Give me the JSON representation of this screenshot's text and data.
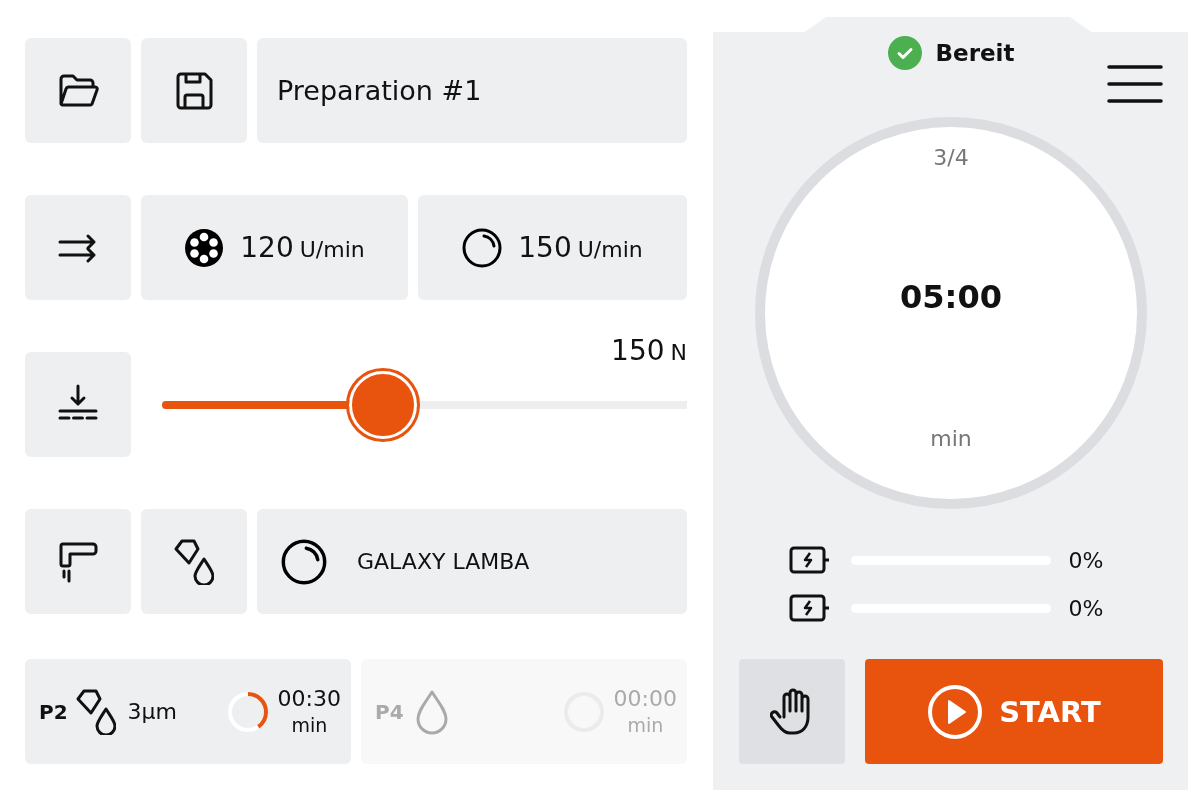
{
  "toolbar": {
    "preparation_name": "Preparation #1"
  },
  "speeds": [
    {
      "kind": "reel",
      "value": "120",
      "unit": "U/min"
    },
    {
      "kind": "disc",
      "value": "150",
      "unit": "U/min"
    }
  ],
  "force": {
    "value": "150",
    "unit": "N",
    "level": 0.42
  },
  "consumable": {
    "kind": "disc",
    "name": "GALAXY LAMBA"
  },
  "steps": [
    {
      "label": "P2",
      "kind": "diamond-drop",
      "amount": "3µm",
      "time": "00:30",
      "unit": "min",
      "disabled": false
    },
    {
      "label": "P4",
      "kind": "drop",
      "time": "00:00",
      "unit": "min",
      "disabled": true
    }
  ],
  "status": {
    "label": "Bereit"
  },
  "timer": {
    "step": "3/4",
    "time": "05:00",
    "unit": "min"
  },
  "batteries": [
    {
      "level": 0,
      "reading": "0%"
    },
    {
      "level": 0,
      "reading": "0%"
    }
  ],
  "start_button": {
    "label": "START"
  }
}
